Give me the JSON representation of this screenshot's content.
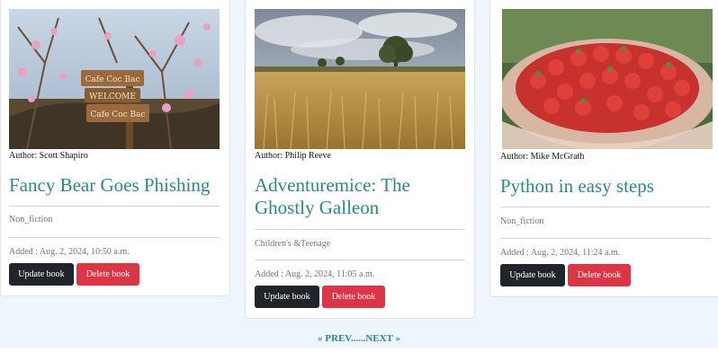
{
  "books": [
    {
      "author_label": "Author: Scott Shapiro",
      "title": "Fancy Bear Goes Phishing",
      "category": "Non_fiction",
      "added": "Added : Aug. 2, 2024, 10:50 a.m.",
      "update_label": "Update book",
      "delete_label": "Delete book",
      "image": "cafe-sign-blossom-photo",
      "sign_lines": [
        "Cafe Coc Bac",
        "WELCOME",
        "Cafe Coc Bac"
      ]
    },
    {
      "author_label": "Author: Philip Reeve",
      "title": "Adventuremice: The Ghostly Galleon",
      "category": "Children's &Teenage",
      "added": "Added : Aug. 2, 2024, 11:05 a.m.",
      "update_label": "Update book",
      "delete_label": "Delete book",
      "image": "wheat-field-photo"
    },
    {
      "author_label": "Author: Mike McGrath",
      "title": "Python in easy steps",
      "category": "Non_fiction",
      "added": "Added : Aug. 2, 2024, 11:24 a.m.",
      "update_label": "Update book",
      "delete_label": "Delete book",
      "image": "strawberry-basket-photo"
    }
  ],
  "pagination": {
    "prev_label": "« PREV",
    "separator": "......",
    "next_label": "NEXT »"
  },
  "colors": {
    "title": "#2a8a84",
    "update_button": "#212529",
    "delete_button": "#dc3545",
    "page_background": "#eef5fc"
  }
}
